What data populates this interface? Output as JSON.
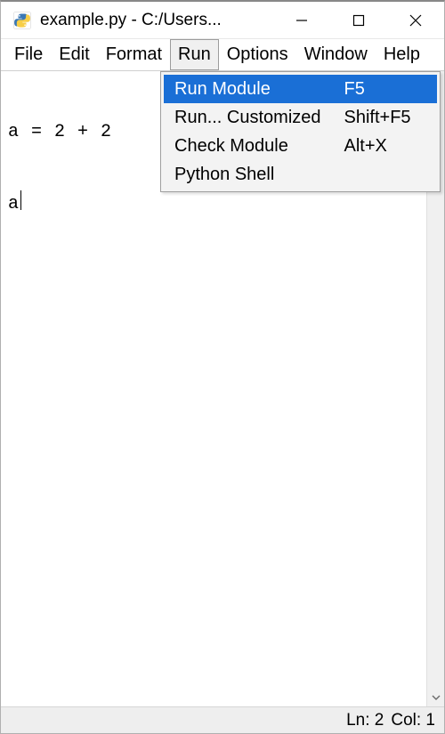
{
  "titlebar": {
    "title": "example.py - C:/Users..."
  },
  "menubar": {
    "items": [
      {
        "label": "File"
      },
      {
        "label": "Edit"
      },
      {
        "label": "Format"
      },
      {
        "label": "Run"
      },
      {
        "label": "Options"
      },
      {
        "label": "Window"
      },
      {
        "label": "Help"
      }
    ],
    "open_index": 3
  },
  "dropdown": {
    "items": [
      {
        "label": "Run Module",
        "shortcut": "F5",
        "highlighted": true
      },
      {
        "label": "Run... Customized",
        "shortcut": "Shift+F5",
        "highlighted": false
      },
      {
        "label": "Check Module",
        "shortcut": "Alt+X",
        "highlighted": false
      },
      {
        "label": "Python Shell",
        "shortcut": "",
        "highlighted": false
      }
    ]
  },
  "editor": {
    "lines": [
      "a = 2 + 2",
      "a"
    ],
    "cursor_line": 1,
    "cursor_visible": true
  },
  "statusbar": {
    "line_label": "Ln: 2",
    "col_label": "Col: 1"
  }
}
